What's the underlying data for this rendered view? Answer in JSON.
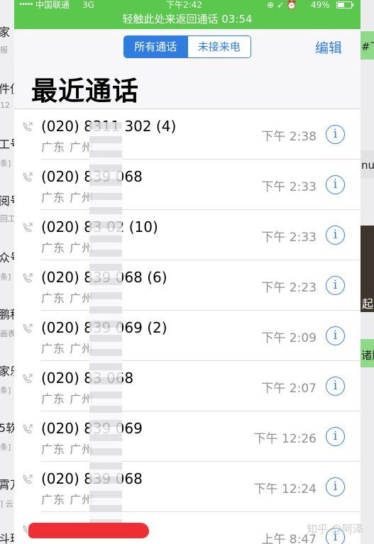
{
  "status_bar": {
    "signal": "•••••",
    "carrier": "中国联通",
    "network": "3G",
    "time": "下午2:42",
    "icons": "⊕ ➶ ⏰",
    "battery": "49%"
  },
  "return_banner": "轻触此处来返回通话 03:54",
  "segment": {
    "all_calls": "所有通话",
    "missed_calls": "未接来电"
  },
  "edit_label": "编辑",
  "title": "最近通话",
  "calls": [
    {
      "number": "(020) 8311  302 (4)",
      "location": "广东 广州",
      "time": "下午 2:38"
    },
    {
      "number": "(020) 839      068",
      "location": "广东 广州",
      "time": "下午 2:33"
    },
    {
      "number": "(020) 83       02 (10)",
      "location": "广东 广州",
      "time": "下午 2:33"
    },
    {
      "number": "(020) 839      068 (6)",
      "location": "广东 广州",
      "time": "下午 2:23"
    },
    {
      "number": "(020) 839      069 (2)",
      "location": "广东 广州",
      "time": "下午 2:09"
    },
    {
      "number": "(020) 83       068",
      "location": "广东 广州",
      "time": "下午 2:07"
    },
    {
      "number": "(020) 839      069",
      "location": "广东 广州",
      "time": "下午 12:26"
    },
    {
      "number": "(020) 839      068",
      "location": "广东 广州",
      "time": "下午 12:24"
    },
    {
      "number": "",
      "location": "",
      "time": "上午 8:47"
    }
  ],
  "info_glyph": "i",
  "watermark": "知乎 @阿泽",
  "background_left": [
    "家",
    "报",
    "件偵",
    "12",
    "工号",
    "条]",
    "阅号",
    "回工",
    "众号",
    "条]",
    "鹏程",
    "画表",
    "家乐",
    "条]",
    "5软",
    "条]",
    "霄万",
    "] 云",
    "斗玕"
  ],
  "background_right": [
    "#下",
    "nua",
    "起",
    "诸邱"
  ],
  "colors": {
    "accent": "#2f7ddf",
    "banner": "#5ac84d",
    "redaction": "#ef2f33"
  },
  "icons": {
    "call_type": "handset-outgoing-icon",
    "detail": "info-circle-icon",
    "battery": "battery-icon"
  }
}
